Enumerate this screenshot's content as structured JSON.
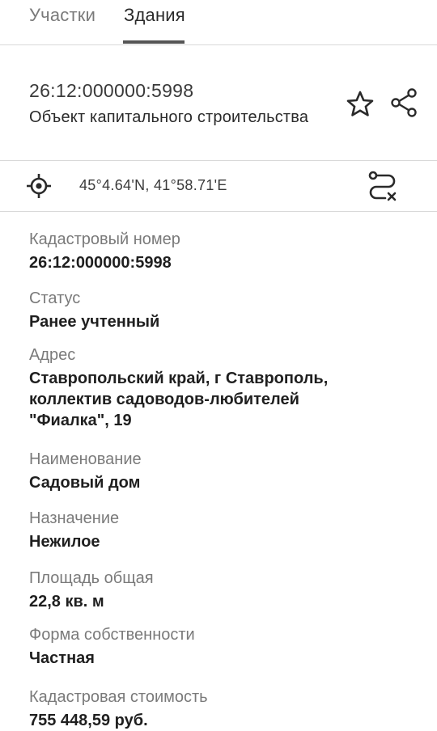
{
  "tabs": [
    {
      "label": "Участки"
    },
    {
      "label": "Здания"
    }
  ],
  "object": {
    "cadastral_number": "26:12:000000:5998",
    "type": "Объект капитального строительства"
  },
  "coords": {
    "text": "45°4.64'N, 41°58.71'E"
  },
  "details": {
    "cadastral_label": "Кадастровый номер",
    "cadastral_value": "26:12:000000:5998",
    "status_label": "Статус",
    "status_value": "Ранее учтенный",
    "address_label": "Адрес",
    "address_line1": "Ставропольский край, г Ставрополь,",
    "address_line2": "коллектив садоводов-любителей",
    "address_line3": "\"Фиалка\", 19",
    "name_label": "Наименование",
    "name_value": "Садовый дом",
    "purpose_label": "Назначение",
    "purpose_value": "Нежилое",
    "area_label": "Площадь общая",
    "area_value": "22,8 кв. м",
    "ownership_label": "Форма собственности",
    "ownership_value": "Частная",
    "cost_label": "Кадастровая стоимость",
    "cost_value": "755 448,59 руб."
  },
  "icons": {
    "favorite": "star-icon",
    "share": "share-icon",
    "locate": "target-icon",
    "route": "route-off-icon"
  },
  "colors": {
    "text_primary": "#1f1f1f",
    "text_secondary": "#7a7a7a",
    "divider": "#d9d9d9",
    "active_tab_indicator": "#555555"
  }
}
